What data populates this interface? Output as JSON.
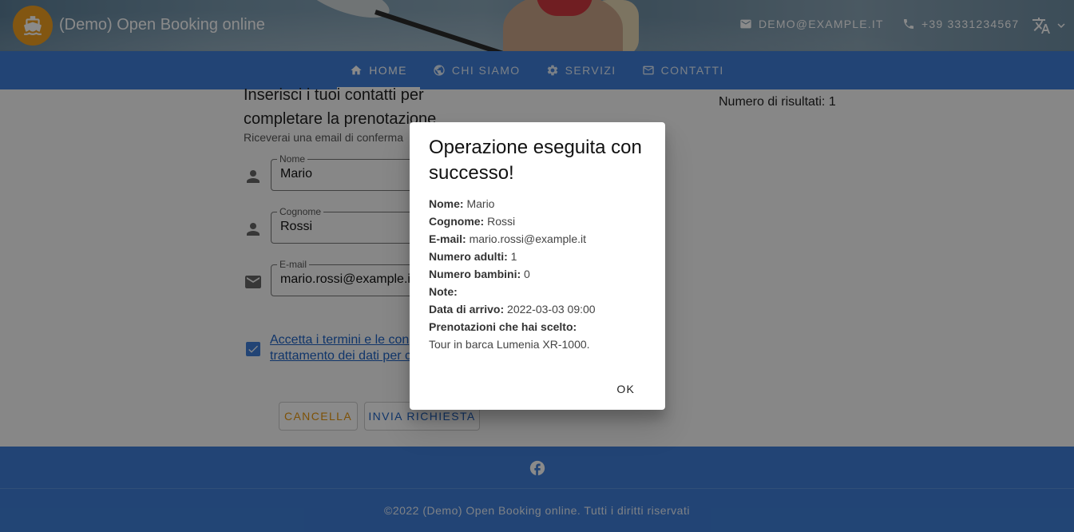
{
  "header": {
    "site_title": "(Demo) Open Booking online",
    "email": "DEMO@EXAMPLE.IT",
    "phone": "+39 3331234567",
    "icons": {
      "logo": "ship-icon",
      "email": "email-icon",
      "phone": "phone-icon",
      "language": "translate-icon"
    }
  },
  "nav": {
    "items": [
      {
        "label": "HOME",
        "icon": "home-icon",
        "active": true
      },
      {
        "label": "CHI SIAMO",
        "icon": "globe-icon"
      },
      {
        "label": "SERVIZI",
        "icon": "gear-icon"
      },
      {
        "label": "CONTATTI",
        "icon": "email-icon"
      }
    ]
  },
  "form": {
    "title_lines": [
      "Inserisci i tuoi contatti per",
      "completare la prenotazione"
    ],
    "subtitle": "Riceverai una email di conferma",
    "fields": {
      "name": {
        "label": "Nome",
        "value": "Mario"
      },
      "surname": {
        "label": "Cognome",
        "value": "Rossi"
      },
      "email": {
        "label": "E-mail",
        "value": "mario.rossi@example.it"
      }
    },
    "terms_line1": "Accetta i termini e le con",
    "terms_line2": "trattamento dei dati per c",
    "terms_checked": true,
    "cancel_label": "CANCELLA",
    "submit_label": "INVIA RICHIESTA"
  },
  "results": {
    "text": "Numero di risultati: 1"
  },
  "dialog": {
    "title": "Operazione eseguita con successo!",
    "rows": [
      {
        "label": "Nome:",
        "value": "Mario"
      },
      {
        "label": "Cognome:",
        "value": "Rossi"
      },
      {
        "label": "E-mail:",
        "value": "mario.rossi@example.it"
      },
      {
        "label": "Numero adulti:",
        "value": "1"
      },
      {
        "label": "Numero bambini:",
        "value": "0"
      },
      {
        "label": "Note:",
        "value": ""
      },
      {
        "label": "Data di arrivo:",
        "value": "2022-03-03 09:00"
      },
      {
        "label": "Prenotazioni che hai scelto:",
        "value": ""
      }
    ],
    "booking": "Tour in barca Lumenia XR-1000.",
    "ok_label": "OK"
  },
  "footer": {
    "copyright": "©2022 (Demo) Open Booking online. Tutti i diritti riservati",
    "social_icon": "facebook-icon"
  },
  "colors": {
    "primary": "#3f7fd8",
    "accent": "#f0a020",
    "cancel": "#e8960c"
  }
}
